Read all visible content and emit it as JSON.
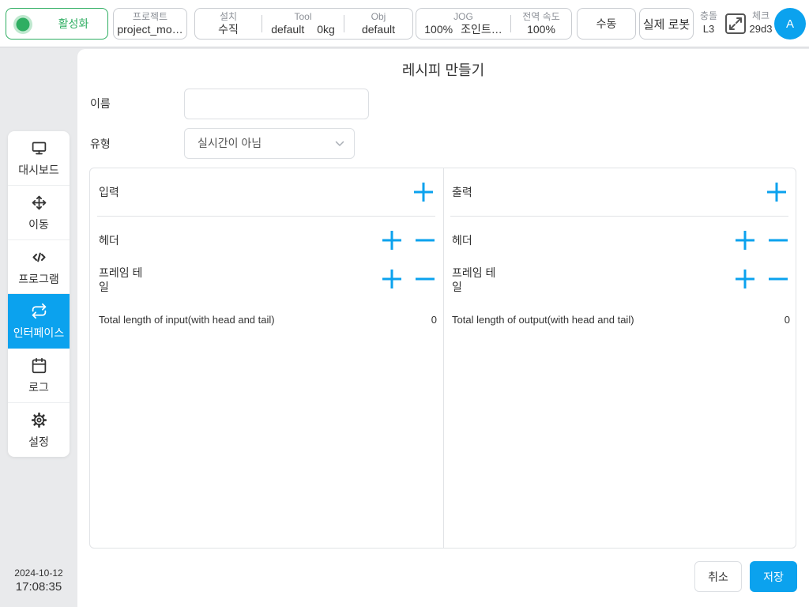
{
  "topbar": {
    "activate": {
      "label": "활성화",
      "icon": "status-dot-icon"
    },
    "project": {
      "label": "프로젝트",
      "value": "project_mo…"
    },
    "install": {
      "label": "설치",
      "value": "수직"
    },
    "tool": {
      "label": "Tool",
      "name": "default",
      "weight": "0kg"
    },
    "obj": {
      "label": "Obj",
      "value": "default"
    },
    "jog": {
      "label": "JOG",
      "speed": "100%",
      "mode": "조인트…"
    },
    "global_speed": {
      "label": "전역 속도",
      "value": "100%"
    },
    "manual": {
      "label": "수동"
    },
    "real_robot": {
      "label": "실제 로봇"
    },
    "collision": {
      "label": "충돌",
      "value": "L3"
    },
    "expand": {
      "icon": "expand-icon"
    },
    "check": {
      "label": "체크",
      "value": "29d3"
    },
    "avatar": {
      "initial": "A"
    }
  },
  "sidebar": {
    "items": [
      {
        "label": "대시보드",
        "icon": "monitor-icon",
        "active": false
      },
      {
        "label": "이동",
        "icon": "move-icon",
        "active": false
      },
      {
        "label": "프로그램",
        "icon": "code-icon",
        "active": false
      },
      {
        "label": "인터페이스",
        "icon": "swap-icon",
        "active": true
      },
      {
        "label": "로그",
        "icon": "calendar-icon",
        "active": false
      },
      {
        "label": "설정",
        "icon": "gear-icon",
        "active": false
      }
    ]
  },
  "clock": {
    "date": "2024-10-12",
    "time": "17:08:35"
  },
  "dialog": {
    "title": "레시피 만들기",
    "name_field": {
      "label": "이름",
      "value": ""
    },
    "type_field": {
      "label": "유형",
      "selected": "실시간이 아님"
    },
    "input": {
      "title": "입력",
      "header_label": "헤더",
      "frame_tail_label": "프레임 테일",
      "total_label": "Total length of input(with head and tail)",
      "total_value": "0"
    },
    "output": {
      "title": "출력",
      "header_label": "헤더",
      "frame_tail_label": "프레임 테일",
      "total_label": "Total length of output(with head and tail)",
      "total_value": "0"
    },
    "cancel_label": "취소",
    "save_label": "저장"
  },
  "colors": {
    "accent": "#0ba2ee",
    "active_green": "#2fae62"
  }
}
